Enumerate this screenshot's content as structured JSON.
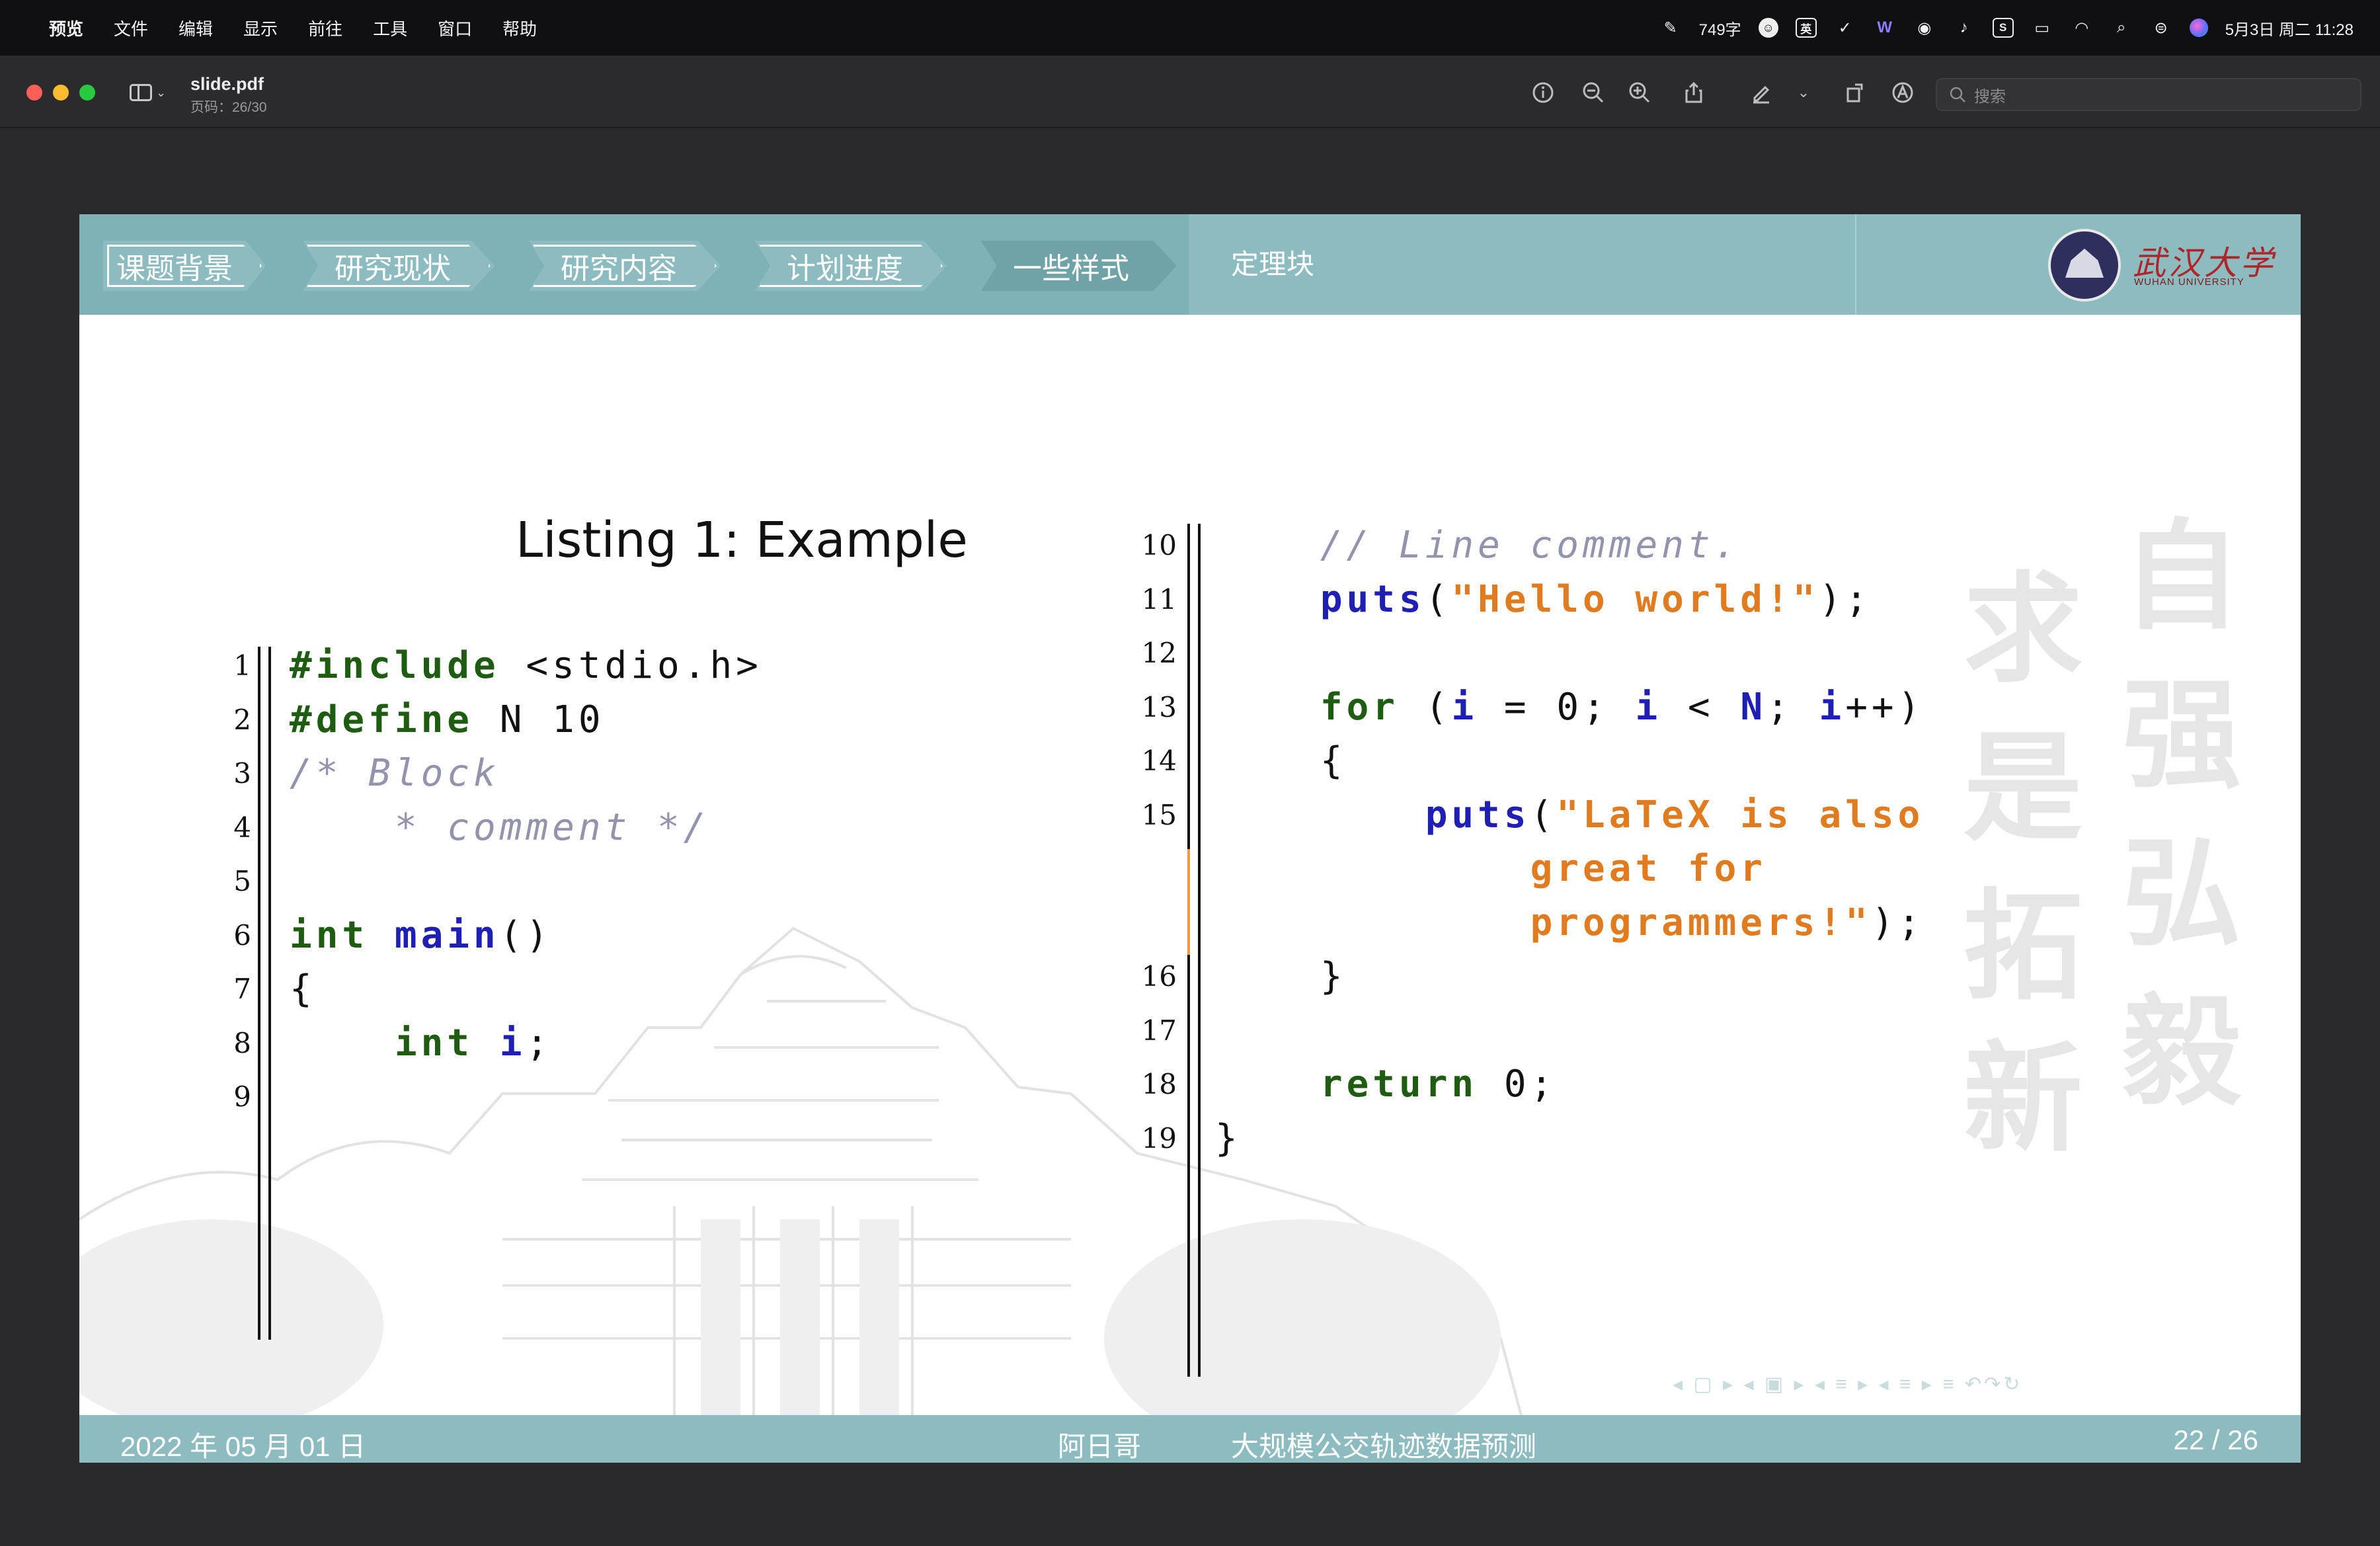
{
  "menubar": {
    "app_name": "预览",
    "items": [
      "文件",
      "编辑",
      "显示",
      "前往",
      "工具",
      "窗口",
      "帮助"
    ],
    "word_count": "749字",
    "input_method": "英",
    "datetime": "5月3日 周二 11:28"
  },
  "toolbar": {
    "doc_title": "slide.pdf",
    "page_info": "页码：26/30",
    "search_placeholder": "搜索"
  },
  "slide": {
    "nav_tabs": [
      "课题背景",
      "研究现状",
      "研究内容",
      "计划进度",
      "一些样式"
    ],
    "active_tab_index": 4,
    "section_title": "定理块",
    "logo_text": "武汉大学",
    "logo_subtext": "WUHAN UNIVERSITY",
    "listing_caption": "Listing 1:  Example",
    "code_lines_left": [
      {
        "n": "1",
        "tokens": [
          {
            "t": "#include",
            "c": "pp"
          },
          {
            "t": " <stdio.h>",
            "c": "pl"
          }
        ]
      },
      {
        "n": "2",
        "tokens": [
          {
            "t": "#define",
            "c": "pp"
          },
          {
            "t": " N 10",
            "c": "pl"
          }
        ]
      },
      {
        "n": "3",
        "tokens": [
          {
            "t": "/* Block",
            "c": "cm"
          }
        ]
      },
      {
        "n": "4",
        "tokens": [
          {
            "t": "    * comment */",
            "c": "cm"
          }
        ]
      },
      {
        "n": "5",
        "tokens": []
      },
      {
        "n": "6",
        "tokens": [
          {
            "t": "int",
            "c": "kw"
          },
          {
            "t": " ",
            "c": "pl"
          },
          {
            "t": "main",
            "c": "fn"
          },
          {
            "t": "()",
            "c": "pl"
          }
        ]
      },
      {
        "n": "7",
        "tokens": [
          {
            "t": "{",
            "c": "pl"
          }
        ]
      },
      {
        "n": "8",
        "tokens": [
          {
            "t": "    int",
            "c": "kw"
          },
          {
            "t": " ",
            "c": "pl"
          },
          {
            "t": "i",
            "c": "id"
          },
          {
            "t": ";",
            "c": "pl"
          }
        ]
      },
      {
        "n": "9",
        "tokens": []
      }
    ],
    "code_lines_right": [
      {
        "n": "10",
        "tokens": [
          {
            "t": "    // Line comment.",
            "c": "cm"
          }
        ]
      },
      {
        "n": "11",
        "tokens": [
          {
            "t": "    puts",
            "c": "fn"
          },
          {
            "t": "(",
            "c": "pl"
          },
          {
            "t": "\"Hello world!\"",
            "c": "str"
          },
          {
            "t": ");",
            "c": "pl"
          }
        ]
      },
      {
        "n": "12",
        "tokens": []
      },
      {
        "n": "13",
        "tokens": [
          {
            "t": "    for",
            "c": "kw"
          },
          {
            "t": " (",
            "c": "pl"
          },
          {
            "t": "i",
            "c": "id"
          },
          {
            "t": " = 0; ",
            "c": "pl"
          },
          {
            "t": "i",
            "c": "id"
          },
          {
            "t": " < ",
            "c": "pl"
          },
          {
            "t": "N",
            "c": "id"
          },
          {
            "t": "; ",
            "c": "pl"
          },
          {
            "t": "i",
            "c": "id"
          },
          {
            "t": "++)",
            "c": "pl"
          }
        ]
      },
      {
        "n": "14",
        "tokens": [
          {
            "t": "    {",
            "c": "pl"
          }
        ]
      },
      {
        "n": "15",
        "tokens": [
          {
            "t": "        puts",
            "c": "fn"
          },
          {
            "t": "(",
            "c": "pl"
          },
          {
            "t": "\"LaTeX is also",
            "c": "str"
          }
        ]
      },
      {
        "n": "",
        "tokens": [
          {
            "t": "            great for",
            "c": "str"
          }
        ]
      },
      {
        "n": "",
        "tokens": [
          {
            "t": "            programmers!\"",
            "c": "str"
          },
          {
            "t": ");",
            "c": "pl"
          }
        ]
      },
      {
        "n": "16",
        "tokens": [
          {
            "t": "    }",
            "c": "pl"
          }
        ]
      },
      {
        "n": "17",
        "tokens": []
      },
      {
        "n": "18",
        "tokens": [
          {
            "t": "    return",
            "c": "kw"
          },
          {
            "t": " 0;",
            "c": "pl"
          }
        ]
      },
      {
        "n": "19",
        "tokens": [
          {
            "t": "}",
            "c": "pl"
          }
        ]
      }
    ],
    "calligraphy": [
      "自",
      "强",
      "弘",
      "毅",
      "求",
      "是",
      "拓",
      "新"
    ],
    "nav_controls": "◂ ▢ ▸  ◂ ▣ ▸  ◂ ≡ ▸  ◂ ≡ ▸   ≡   ↶↷↻",
    "footer": {
      "date": "2022 年 05 月 01 日",
      "author": "阿日哥",
      "title": "大规模公交轨迹数据预测",
      "page": "22 / 26"
    }
  },
  "colors": {
    "theme": "#8dbcc0",
    "keyword": "#1e5c12",
    "identifier": "#1f1fb3",
    "string": "#e07c1f",
    "comment": "#9393ad"
  }
}
